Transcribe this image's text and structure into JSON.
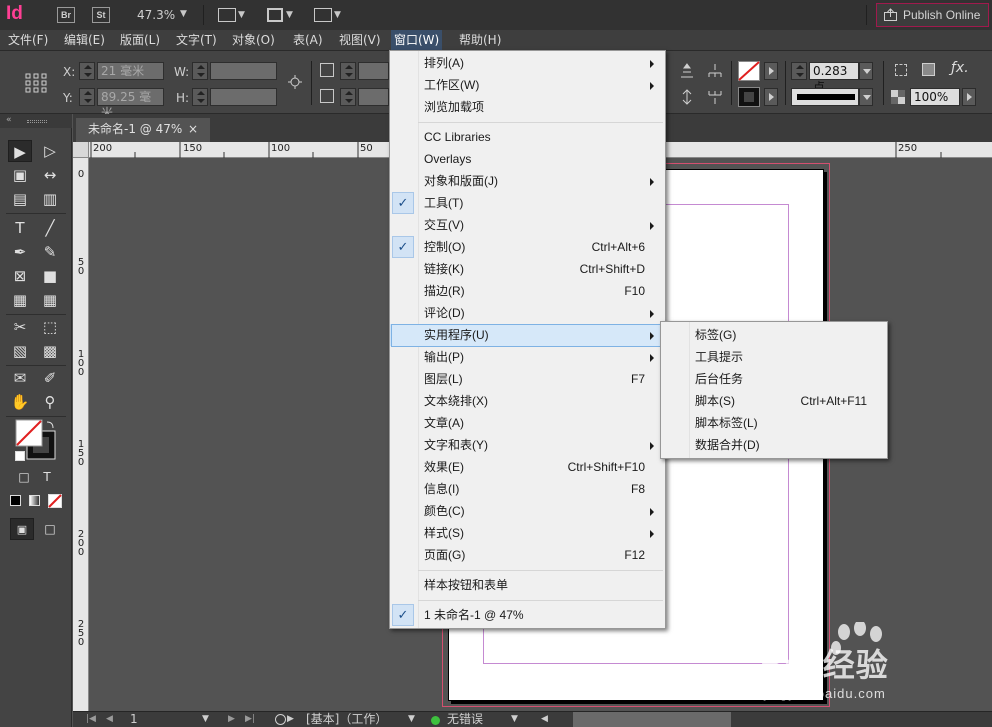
{
  "appbar": {
    "logo": "Id",
    "bridge_badge": "Br",
    "stock_badge": "St",
    "zoom": "47.3%",
    "publish_label": "Publish Online"
  },
  "menubar": [
    "文件(F)",
    "编辑(E)",
    "版面(L)",
    "文字(T)",
    "对象(O)",
    "表(A)",
    "视图(V)",
    "窗口(W)",
    "帮助(H)"
  ],
  "control": {
    "x_label": "X:",
    "x_value": "21 毫米",
    "y_label": "Y:",
    "y_value": "89.25 毫米",
    "w_label": "W:",
    "h_label": "H:",
    "stroke_weight": "0.283 点",
    "opacity": "100%"
  },
  "document": {
    "tab_title": "未命名-1 @ 47%",
    "close": "×",
    "h_ruler": [
      "200",
      "150",
      "100",
      "50",
      "250"
    ],
    "v_ruler": [
      "0",
      "5\n0",
      "1\n0\n0",
      "1\n5\n0",
      "2\n0\n0",
      "2\n5\n0"
    ]
  },
  "statusbar": {
    "page": "1",
    "master": "[基本]（工作）",
    "preflight": "无错误"
  },
  "window_menu": {
    "items": [
      {
        "label": "排列(A)",
        "shortcut": "",
        "submenu": true,
        "checked": false
      },
      {
        "label": "工作区(W)",
        "shortcut": "",
        "submenu": true,
        "checked": false
      },
      {
        "label": "浏览加载项",
        "shortcut": "",
        "submenu": false,
        "checked": false
      },
      {
        "label": "CC Libraries",
        "shortcut": "",
        "submenu": false,
        "checked": false
      },
      {
        "label": "Overlays",
        "shortcut": "",
        "submenu": false,
        "checked": false
      },
      {
        "label": "对象和版面(J)",
        "shortcut": "",
        "submenu": true,
        "checked": false
      },
      {
        "label": "工具(T)",
        "shortcut": "",
        "submenu": false,
        "checked": true
      },
      {
        "label": "交互(V)",
        "shortcut": "",
        "submenu": true,
        "checked": false
      },
      {
        "label": "控制(O)",
        "shortcut": "Ctrl+Alt+6",
        "submenu": false,
        "checked": true
      },
      {
        "label": "链接(K)",
        "shortcut": "Ctrl+Shift+D",
        "submenu": false,
        "checked": false
      },
      {
        "label": "描边(R)",
        "shortcut": "F10",
        "submenu": false,
        "checked": false
      },
      {
        "label": "评论(D)",
        "shortcut": "",
        "submenu": true,
        "checked": false
      },
      {
        "label": "实用程序(U)",
        "shortcut": "",
        "submenu": true,
        "checked": false
      },
      {
        "label": "输出(P)",
        "shortcut": "",
        "submenu": true,
        "checked": false
      },
      {
        "label": "图层(L)",
        "shortcut": "F7",
        "submenu": false,
        "checked": false
      },
      {
        "label": "文本绕排(X)",
        "shortcut": "",
        "submenu": false,
        "checked": false
      },
      {
        "label": "文章(A)",
        "shortcut": "",
        "submenu": false,
        "checked": false
      },
      {
        "label": "文字和表(Y)",
        "shortcut": "",
        "submenu": true,
        "checked": false
      },
      {
        "label": "效果(E)",
        "shortcut": "Ctrl+Shift+F10",
        "submenu": false,
        "checked": false
      },
      {
        "label": "信息(I)",
        "shortcut": "F8",
        "submenu": false,
        "checked": false
      },
      {
        "label": "颜色(C)",
        "shortcut": "",
        "submenu": true,
        "checked": false
      },
      {
        "label": "样式(S)",
        "shortcut": "",
        "submenu": true,
        "checked": false
      },
      {
        "label": "页面(G)",
        "shortcut": "F12",
        "submenu": false,
        "checked": false
      },
      {
        "label": "样本按钮和表单",
        "shortcut": "",
        "submenu": false,
        "checked": false
      },
      {
        "label": "1 未命名-1 @ 47%",
        "shortcut": "",
        "submenu": false,
        "checked": true
      }
    ],
    "check_mark": "✓"
  },
  "utility_submenu": {
    "items": [
      {
        "label": "标签(G)",
        "shortcut": ""
      },
      {
        "label": "工具提示",
        "shortcut": ""
      },
      {
        "label": "后台任务",
        "shortcut": ""
      },
      {
        "label": "脚本(S)",
        "shortcut": "Ctrl+Alt+F11"
      },
      {
        "label": "脚本标签(L)",
        "shortcut": ""
      },
      {
        "label": "数据合并(D)",
        "shortcut": ""
      }
    ]
  },
  "watermark": {
    "main": "Bai 经验",
    "sub": "jingyan.baidu.com"
  },
  "colors": {
    "accent_pink": "#ff3f94",
    "menu_highlight": "#d6e8f9",
    "bleed_guide": "#d45070",
    "margin_guide": "#c58ad2"
  }
}
